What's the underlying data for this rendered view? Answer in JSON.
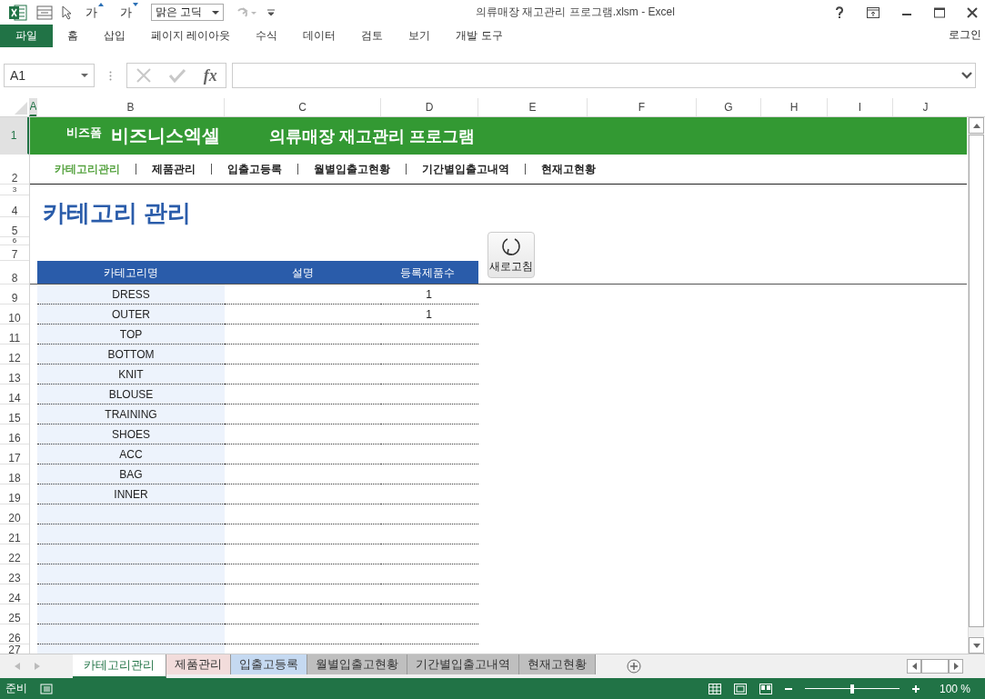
{
  "title_bar": {
    "font_grow": "가",
    "font_shrink": "가",
    "font_box": "맑은 고딕",
    "title": "의류매장 재고관리 프로그램.xlsm - Excel"
  },
  "ribbon": {
    "tabs": [
      {
        "label": "파일",
        "selected": true
      },
      {
        "label": "홈",
        "selected": false
      },
      {
        "label": "삽입",
        "selected": false
      },
      {
        "label": "페이지 레이아웃",
        "selected": false
      },
      {
        "label": "수식",
        "selected": false
      },
      {
        "label": "데이터",
        "selected": false
      },
      {
        "label": "검토",
        "selected": false
      },
      {
        "label": "보기",
        "selected": false
      },
      {
        "label": "개발 도구",
        "selected": false
      }
    ],
    "account": "로그인"
  },
  "formula_bar": {
    "name_box": "A1",
    "function_label": "fx"
  },
  "column_headers": [
    "A",
    "B",
    "C",
    "D",
    "E",
    "F",
    "G",
    "H",
    "I",
    "J"
  ],
  "row_numbers": [
    "1",
    "2",
    "3",
    "4",
    "5",
    "6",
    "7",
    "8",
    "9",
    "10",
    "11",
    "12",
    "13",
    "14",
    "15",
    "16",
    "17",
    "18",
    "19",
    "20",
    "21",
    "22",
    "23",
    "24",
    "25",
    "26",
    "27"
  ],
  "sheet": {
    "banner": {
      "brand_small": "비즈폼",
      "brand": "비즈니스엑셀",
      "title": "의류매장 재고관리 프로그램"
    },
    "nav": [
      {
        "label": "카테고리관리",
        "selected": true
      },
      {
        "label": "제품관리",
        "selected": false
      },
      {
        "label": "입출고등록",
        "selected": false
      },
      {
        "label": "월별입출고현황",
        "selected": false
      },
      {
        "label": "기간별입출고내역",
        "selected": false
      },
      {
        "label": "현재고현황",
        "selected": false
      }
    ],
    "page_title": "카테고리 관리",
    "refresh_button": "새로고침",
    "table": {
      "columns": [
        "카테고리명",
        "설명",
        "등록제품수"
      ],
      "rows": [
        {
          "category": "DRESS",
          "count": "1"
        },
        {
          "category": "OUTER",
          "count": "1"
        },
        {
          "category": "TOP"
        },
        {
          "category": "BOTTOM"
        },
        {
          "category": "KNIT"
        },
        {
          "category": "BLOUSE"
        },
        {
          "category": "TRAINING"
        },
        {
          "category": "SHOES"
        },
        {
          "category": "ACC"
        },
        {
          "category": "BAG"
        },
        {
          "category": "INNER"
        }
      ]
    }
  },
  "sheet_tabs": [
    {
      "label": "카테고리관리",
      "selected": true,
      "color": "#ffffff"
    },
    {
      "label": "제품관리",
      "selected": false,
      "color": "#f2dcdb"
    },
    {
      "label": "입출고등록",
      "selected": false,
      "color": "#c5d9f1"
    },
    {
      "label": "월별입출고현황",
      "selected": false,
      "color": "#bfbfbf"
    },
    {
      "label": "기간별입출고내역",
      "selected": false,
      "color": "#bfbfbf"
    },
    {
      "label": "현재고현황",
      "selected": false,
      "color": "#bfbfbf"
    }
  ],
  "status_bar": {
    "mode": "준비",
    "zoom": "100 %",
    "zoom_slider": {
      "level": 0.5
    }
  }
}
